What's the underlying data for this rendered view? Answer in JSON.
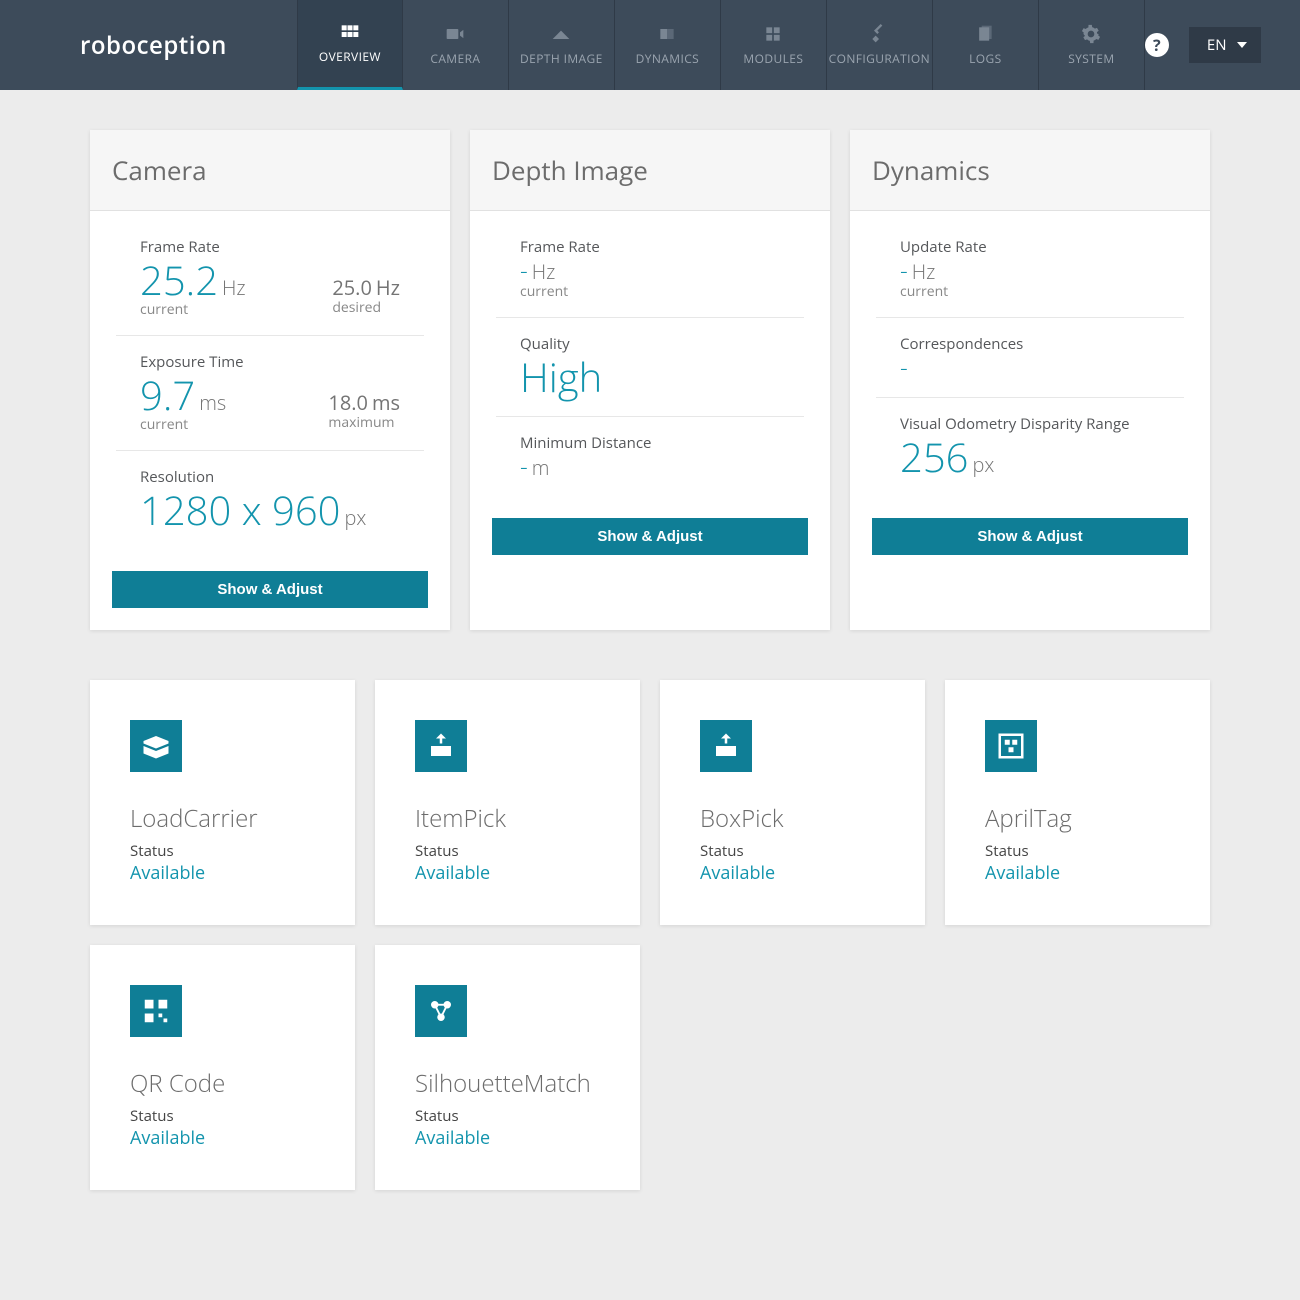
{
  "brand": "roboception",
  "nav": {
    "overview": "OVERVIEW",
    "camera": "CAMERA",
    "depth": "DEPTH IMAGE",
    "dynamics": "DYNAMICS",
    "modules": "MODULES",
    "configuration": "CONFIGURATION",
    "logs": "LOGS",
    "system": "SYSTEM"
  },
  "lang": "EN",
  "panels": {
    "camera": {
      "title": "Camera",
      "frame_rate_label": "Frame Rate",
      "frame_rate_val": "25.2",
      "frame_rate_unit": "Hz",
      "frame_rate_sub": "current",
      "frame_rate_desired_val": "25.0",
      "frame_rate_desired_unit": "Hz",
      "frame_rate_desired_sub": "desired",
      "exposure_label": "Exposure Time",
      "exposure_val": "9.7",
      "exposure_unit": "ms",
      "exposure_sub": "current",
      "exposure_max_val": "18.0",
      "exposure_max_unit": "ms",
      "exposure_max_sub": "maximum",
      "resolution_label": "Resolution",
      "resolution_val": "1280 x 960",
      "resolution_unit": "px",
      "button": "Show & Adjust"
    },
    "depth": {
      "title": "Depth Image",
      "frame_rate_label": "Frame Rate",
      "frame_rate_val": "-",
      "frame_rate_unit": "Hz",
      "frame_rate_sub": "current",
      "quality_label": "Quality",
      "quality_val": "High",
      "mindist_label": "Minimum Distance",
      "mindist_val": "-",
      "mindist_unit": "m",
      "button": "Show & Adjust"
    },
    "dynamics": {
      "title": "Dynamics",
      "update_rate_label": "Update Rate",
      "update_rate_val": "-",
      "update_rate_unit": "Hz",
      "update_rate_sub": "current",
      "correspondences_label": "Correspondences",
      "correspondences_val": "-",
      "vodr_label": "Visual Odometry Disparity Range",
      "vodr_val": "256",
      "vodr_unit": "px",
      "button": "Show & Adjust"
    }
  },
  "modules": {
    "status_label": "Status",
    "items": [
      {
        "title": "LoadCarrier",
        "status": "Available"
      },
      {
        "title": "ItemPick",
        "status": "Available"
      },
      {
        "title": "BoxPick",
        "status": "Available"
      },
      {
        "title": "AprilTag",
        "status": "Available"
      },
      {
        "title": "QR Code",
        "status": "Available"
      },
      {
        "title": "SilhouetteMatch",
        "status": "Available"
      }
    ]
  }
}
